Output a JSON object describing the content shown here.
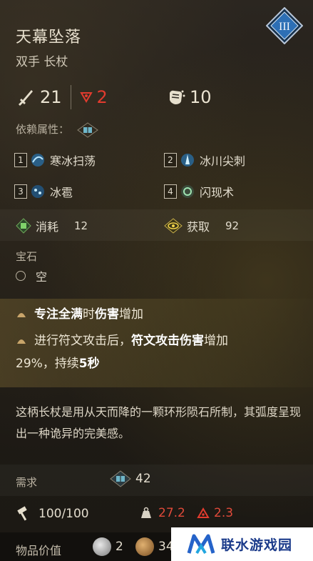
{
  "item": {
    "name": "天幕坠落",
    "type": "双手 长杖",
    "tier_badge": "III"
  },
  "stats": {
    "attack": "21",
    "attack_bonus": "2",
    "defense": "10"
  },
  "dependency": {
    "label": "依赖属性："
  },
  "skills": [
    {
      "slot": "1",
      "name": "寒冰扫荡"
    },
    {
      "slot": "2",
      "name": "冰川尖刺"
    },
    {
      "slot": "3",
      "name": "冰雹"
    },
    {
      "slot": "4",
      "name": "闪现术"
    }
  ],
  "costs": {
    "consume_label": "消耗",
    "consume_value": "12",
    "gain_label": "获取",
    "gain_value": "92"
  },
  "gem": {
    "label": "宝石",
    "slot": "空"
  },
  "affixes": {
    "a1_part1": "专注全满",
    "a1_part2": "时",
    "a1_part3": "伤害",
    "a1_part4": "增加",
    "a2_part1": "进行符文攻击后，",
    "a2_part2": "符文攻击伤害",
    "a2_part3": "增加",
    "a2_part4": "29%，持续",
    "a2_part5": "5秒"
  },
  "lore": "这柄长杖是用从天而降的一颗环形陨石所制，其弧度呈现出一种诡异的完美感。",
  "requirement": {
    "label": "需求",
    "value": "42"
  },
  "durability": {
    "value": "100/100",
    "weight": "27.2",
    "stat2": "2.3"
  },
  "value": {
    "label": "物品价值",
    "coin1": "2",
    "coin2": "34"
  },
  "watermark": {
    "text": "联水游戏园"
  },
  "colors": {
    "red": "#e23b2e",
    "badge_blue": "#2d6fb5"
  }
}
